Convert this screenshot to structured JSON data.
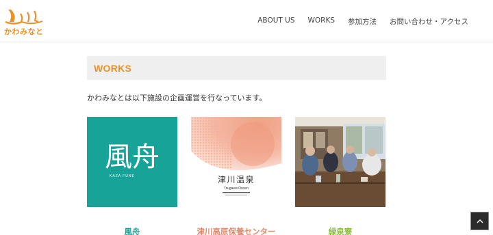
{
  "header": {
    "logo_text": "かわみなと",
    "nav": [
      "ABOUT US",
      "WORKS",
      "参加方法",
      "お問い合わせ・アクセス"
    ]
  },
  "main": {
    "section_title": "WORKS",
    "intro": "かわみなとは以下施設の企画運営を行なっています。"
  },
  "cards": [
    {
      "label": "風舟",
      "logo_text": "風舟",
      "sub_text": "KAZA FUNE",
      "color": "#17a398"
    },
    {
      "label": "津川高原保養センター",
      "logo_text": "津川温泉",
      "sub_text": "Tsugawa Onsen",
      "color": "#e08a6e"
    },
    {
      "label": "緑泉寮",
      "color": "#8cbf3f"
    }
  ],
  "colors": {
    "accent": "#e8922a",
    "bar": "#efefef"
  },
  "icons": {
    "back_to_top": "chevron-up-icon"
  }
}
